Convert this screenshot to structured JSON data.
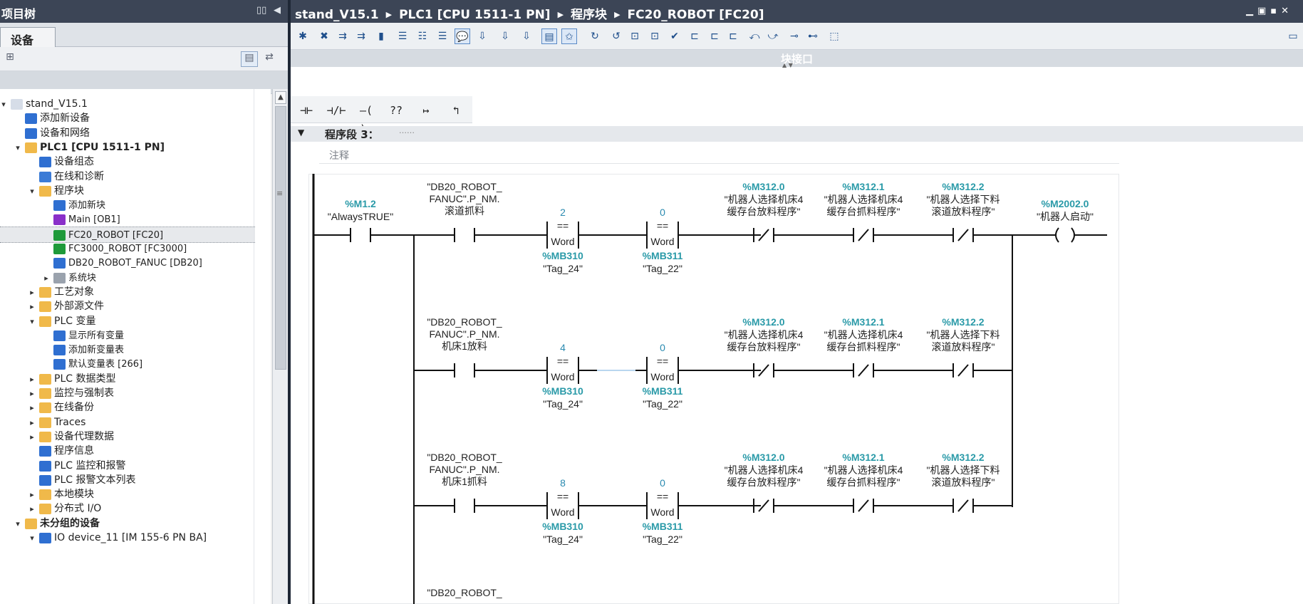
{
  "left_panel": {
    "title": "项目树",
    "tab": "设备"
  },
  "tree": [
    {
      "label": "stand_V15.1",
      "level": 0,
      "expander": "▾",
      "icon_color": "#d6dde8",
      "icon": "project-icon"
    },
    {
      "label": "添加新设备",
      "level": 1,
      "expander": "",
      "icon_color": "#2f6fd1",
      "icon": "add-device-icon"
    },
    {
      "label": "设备和网络",
      "level": 1,
      "expander": "",
      "icon_color": "#2f6fd1",
      "icon": "network-icon"
    },
    {
      "label": "PLC1 [CPU 1511-1 PN]",
      "level": 1,
      "expander": "▾",
      "icon_color": "#f0b94a",
      "icon": "plc-folder-icon",
      "bold": true
    },
    {
      "label": "设备组态",
      "level": 2,
      "expander": "",
      "icon_color": "#2f6fd1",
      "icon": "device-config-icon"
    },
    {
      "label": "在线和诊断",
      "level": 2,
      "expander": "",
      "icon_color": "#3b7bd6",
      "icon": "diagnostics-icon"
    },
    {
      "label": "程序块",
      "level": 2,
      "expander": "▾",
      "icon_color": "#f0b94a",
      "icon": "folder-icon"
    },
    {
      "label": "添加新块",
      "level": 3,
      "expander": "",
      "icon_color": "#2f6fd1",
      "icon": "add-block-icon"
    },
    {
      "label": "Main [OB1]",
      "level": 3,
      "expander": "",
      "icon_color": "#8a2fc9",
      "icon": "ob-block-icon"
    },
    {
      "label": "FC20_ROBOT [FC20]",
      "level": 3,
      "expander": "",
      "icon_color": "#1e9a3a",
      "icon": "fc-block-icon",
      "selected": true
    },
    {
      "label": "FC3000_ROBOT [FC3000]",
      "level": 3,
      "expander": "",
      "icon_color": "#1e9a3a",
      "icon": "fc-block-icon"
    },
    {
      "label": "DB20_ROBOT_FANUC [DB20]",
      "level": 3,
      "expander": "",
      "icon_color": "#2f6fd1",
      "icon": "db-block-icon"
    },
    {
      "label": "系统块",
      "level": 3,
      "expander": "▸",
      "icon_color": "#9aa2ad",
      "icon": "folder-icon"
    },
    {
      "label": "工艺对象",
      "level": 2,
      "expander": "▸",
      "icon_color": "#f0b94a",
      "icon": "folder-icon"
    },
    {
      "label": "外部源文件",
      "level": 2,
      "expander": "▸",
      "icon_color": "#f0b94a",
      "icon": "folder-icon"
    },
    {
      "label": "PLC 变量",
      "level": 2,
      "expander": "▾",
      "icon_color": "#f0b94a",
      "icon": "folder-icon"
    },
    {
      "label": "显示所有变量",
      "level": 3,
      "expander": "",
      "icon_color": "#2f6fd1",
      "icon": "tag-table-icon"
    },
    {
      "label": "添加新变量表",
      "level": 3,
      "expander": "",
      "icon_color": "#2f6fd1",
      "icon": "add-tag-table-icon"
    },
    {
      "label": "默认变量表 [266]",
      "level": 3,
      "expander": "",
      "icon_color": "#2f6fd1",
      "icon": "tag-table-icon"
    },
    {
      "label": "PLC 数据类型",
      "level": 2,
      "expander": "▸",
      "icon_color": "#f0b94a",
      "icon": "folder-icon"
    },
    {
      "label": "监控与强制表",
      "level": 2,
      "expander": "▸",
      "icon_color": "#f0b94a",
      "icon": "folder-icon"
    },
    {
      "label": "在线备份",
      "level": 2,
      "expander": "▸",
      "icon_color": "#f0b94a",
      "icon": "folder-icon"
    },
    {
      "label": "Traces",
      "level": 2,
      "expander": "▸",
      "icon_color": "#f0b94a",
      "icon": "folder-icon"
    },
    {
      "label": "设备代理数据",
      "level": 2,
      "expander": "▸",
      "icon_color": "#f0b94a",
      "icon": "folder-icon"
    },
    {
      "label": "程序信息",
      "level": 2,
      "expander": "",
      "icon_color": "#2f6fd1",
      "icon": "program-info-icon"
    },
    {
      "label": "PLC 监控和报警",
      "level": 2,
      "expander": "",
      "icon_color": "#2f6fd1",
      "icon": "alarm-icon"
    },
    {
      "label": "PLC 报警文本列表",
      "level": 2,
      "expander": "",
      "icon_color": "#2f6fd1",
      "icon": "text-list-icon"
    },
    {
      "label": "本地模块",
      "level": 2,
      "expander": "▸",
      "icon_color": "#f0b94a",
      "icon": "folder-icon"
    },
    {
      "label": "分布式 I/O",
      "level": 2,
      "expander": "▸",
      "icon_color": "#f0b94a",
      "icon": "folder-icon"
    },
    {
      "label": "未分组的设备",
      "level": 1,
      "expander": "▾",
      "icon_color": "#f0b94a",
      "icon": "folder-icon",
      "bold": true
    },
    {
      "label": "IO device_11 [IM 155-6 PN BA]",
      "level": 2,
      "expander": "▾",
      "icon_color": "#2f6fd1",
      "icon": "io-device-icon",
      "clipped": true
    }
  ],
  "breadcrumb": [
    "stand_V15.1",
    "PLC1 [CPU 1511-1 PN]",
    "程序块",
    "FC20_ROBOT [FC20]"
  ],
  "block_interface_label": "块接口",
  "lad_tools": [
    "⊣⊢",
    "⊣/⊢",
    "–( )–",
    "??",
    "↦",
    "↰"
  ],
  "network": {
    "title": "程序段 3：",
    "dots": "……",
    "comment": "注释"
  },
  "contacts": {
    "always_true": {
      "addr": "%M1.2",
      "name": "\"AlwaysTRUE\""
    },
    "coil": {
      "addr": "%M2002.0",
      "name": "\"机器人启动\""
    },
    "nc1": {
      "addr": "%M312.0",
      "name1": "\"机器人选择机床4",
      "name2": "缓存台放料程序\""
    },
    "nc2": {
      "addr": "%M312.1",
      "name1": "\"机器人选择机床4",
      "name2": "缓存台抓料程序\""
    },
    "nc3": {
      "addr": "%M312.2",
      "name1": "\"机器人选择下料",
      "name2": "滚道放料程序\""
    }
  },
  "compare": {
    "op": "==",
    "type": "Word",
    "in2_addr_a": "%MB310",
    "in2_name_a": "\"Tag_24\"",
    "in2_addr_b": "%MB311",
    "in2_name_b": "\"Tag_22\""
  },
  "rungs": [
    {
      "db1": "\"DB20_ROBOT_",
      "db2": "FANUC\".P_NM.",
      "db3": "滚道抓料",
      "cmp_a": "2",
      "cmp_b": "0"
    },
    {
      "db1": "\"DB20_ROBOT_",
      "db2": "FANUC\".P_NM.",
      "db3": "机床1放料",
      "cmp_a": "4",
      "cmp_b": "0"
    },
    {
      "db1": "\"DB20_ROBOT_",
      "db2": "FANUC\".P_NM.",
      "db3": "机床1抓料",
      "cmp_a": "8",
      "cmp_b": "0"
    },
    {
      "db1": "\"DB20_ROBOT_",
      "db2": "",
      "db3": "",
      "cmp_a": "",
      "cmp_b": ""
    }
  ]
}
